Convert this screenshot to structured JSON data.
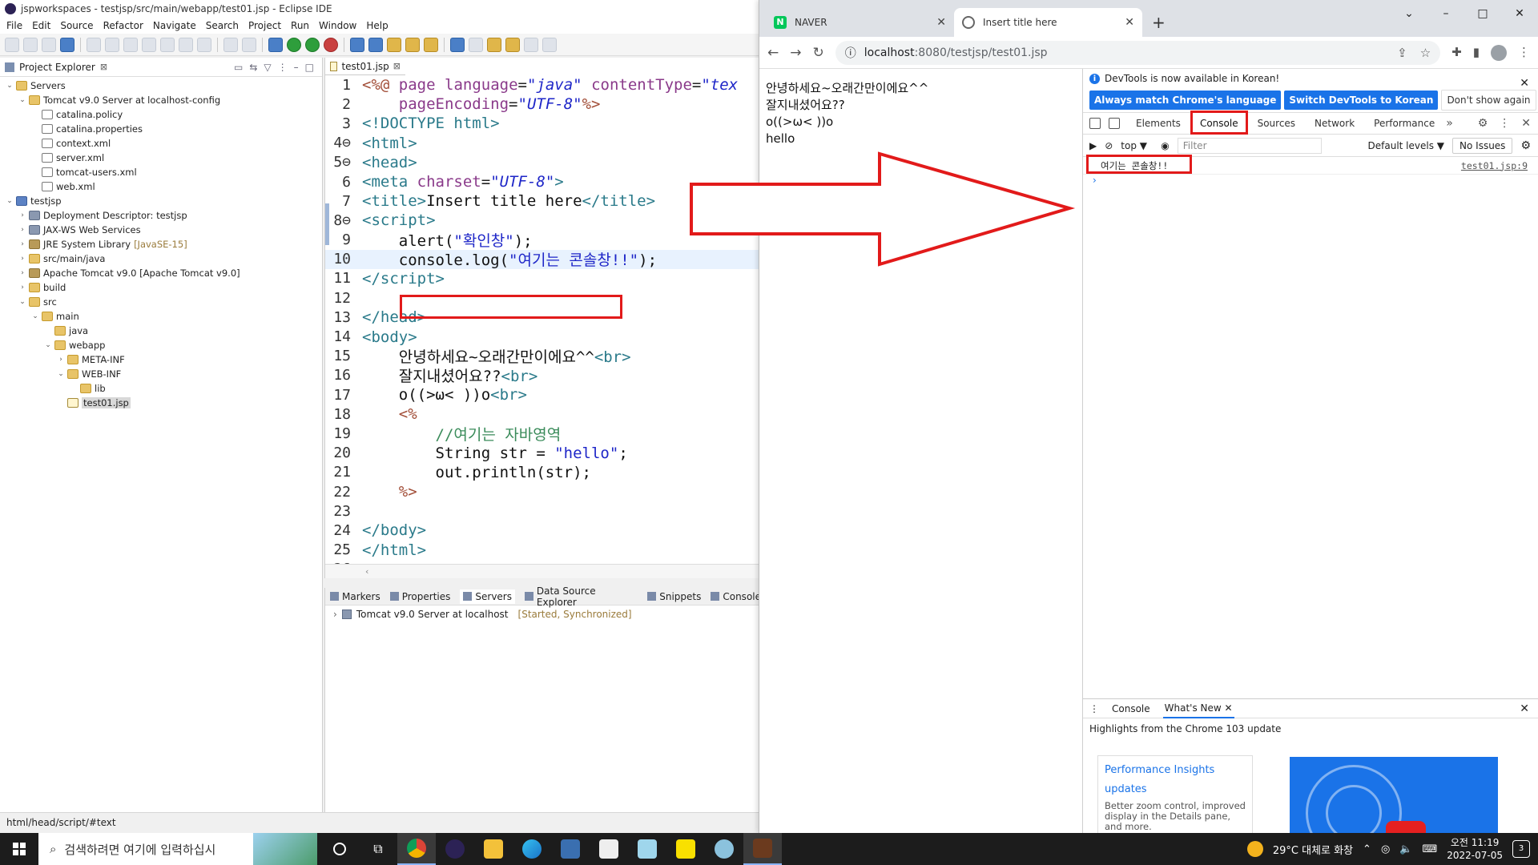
{
  "eclipse": {
    "window_title": "jspworkspaces - testjsp/src/main/webapp/test01.jsp - Eclipse IDE",
    "menu": [
      "File",
      "Edit",
      "Source",
      "Refactor",
      "Navigate",
      "Search",
      "Project",
      "Run",
      "Window",
      "Help"
    ],
    "project_explorer": {
      "tab_label": "Project Explorer",
      "tab_close": "⊠",
      "tree": [
        {
          "label": "Servers",
          "icon": "folder-icon",
          "twisty": "⌄",
          "level": 0
        },
        {
          "label": "Tomcat v9.0 Server at localhost-config",
          "icon": "folder-icon",
          "twisty": "⌄",
          "level": 1
        },
        {
          "label": "catalina.policy",
          "icon": "file-icon",
          "twisty": "",
          "level": 2
        },
        {
          "label": "catalina.properties",
          "icon": "file-icon",
          "twisty": "",
          "level": 2
        },
        {
          "label": "context.xml",
          "icon": "xml-file-icon",
          "twisty": "",
          "level": 2
        },
        {
          "label": "server.xml",
          "icon": "xml-file-icon",
          "twisty": "",
          "level": 2
        },
        {
          "label": "tomcat-users.xml",
          "icon": "xml-file-icon",
          "twisty": "",
          "level": 2
        },
        {
          "label": "web.xml",
          "icon": "xml-file-icon",
          "twisty": "",
          "level": 2
        },
        {
          "label": "testjsp",
          "icon": "project-icon",
          "twisty": "⌄",
          "level": 0
        },
        {
          "label": "Deployment Descriptor: testjsp",
          "icon": "descriptor-icon",
          "twisty": "›",
          "level": 1
        },
        {
          "label": "JAX-WS Web Services",
          "icon": "webservice-icon",
          "twisty": "›",
          "level": 1
        },
        {
          "label": "JRE System Library",
          "note": "[JavaSE-15]",
          "icon": "library-icon",
          "twisty": "›",
          "level": 1
        },
        {
          "label": "src/main/java",
          "icon": "source-folder-icon",
          "twisty": "›",
          "level": 1
        },
        {
          "label": "Apache Tomcat v9.0 [Apache Tomcat v9.0]",
          "icon": "library-icon",
          "twisty": "›",
          "level": 1
        },
        {
          "label": "build",
          "icon": "folder-icon",
          "twisty": "›",
          "level": 1
        },
        {
          "label": "src",
          "icon": "folder-icon",
          "twisty": "⌄",
          "level": 1
        },
        {
          "label": "main",
          "icon": "folder-icon",
          "twisty": "⌄",
          "level": 2
        },
        {
          "label": "java",
          "icon": "folder-icon",
          "twisty": "",
          "level": 3
        },
        {
          "label": "webapp",
          "icon": "folder-icon",
          "twisty": "⌄",
          "level": 3
        },
        {
          "label": "META-INF",
          "icon": "folder-icon",
          "twisty": "›",
          "level": 4
        },
        {
          "label": "WEB-INF",
          "icon": "folder-icon",
          "twisty": "⌄",
          "level": 4
        },
        {
          "label": "lib",
          "icon": "folder-icon",
          "twisty": "",
          "level": 5
        },
        {
          "label": "test01.jsp",
          "icon": "jsp-file-icon",
          "twisty": "",
          "level": 4,
          "selected": true
        }
      ]
    },
    "editor": {
      "tab_label": "test01.jsp",
      "tab_close": "⊠",
      "lines": [
        {
          "n": "1",
          "html": "<span class='k-dir'>&lt;%@</span> <span class='k-attr'>page</span> <span class='k-attr'>language</span>=<span class='k-ital'>\"java\"</span> <span class='k-attr'>contentType</span>=<span class='k-ital'>\"tex</span>"
        },
        {
          "n": "2",
          "html": "    <span class='k-attr'>pageEncoding</span>=<span class='k-ital'>\"UTF-8\"</span><span class='k-dir'>%&gt;</span>"
        },
        {
          "n": "3",
          "html": "<span class='k-tag'>&lt;!DOCTYPE html&gt;</span>"
        },
        {
          "n": "4⊖",
          "html": "<span class='k-tag'>&lt;html&gt;</span>"
        },
        {
          "n": "5⊖",
          "html": "<span class='k-tag'>&lt;head&gt;</span>"
        },
        {
          "n": "6",
          "html": "<span class='k-tag'>&lt;meta</span> <span class='k-attr'>charset</span>=<span class='k-ital'>\"UTF-8\"</span><span class='k-tag'>&gt;</span>"
        },
        {
          "n": "7",
          "html": "<span class='k-tag'>&lt;title&gt;</span><span class='k-plain'>Insert title here</span><span class='k-tag'>&lt;/title&gt;</span>"
        },
        {
          "n": "8⊖",
          "html": "<span class='k-tag'>&lt;script&gt;</span>"
        },
        {
          "n": "9",
          "html": "    <span class='k-plain'>alert(</span><span class='k-str'>\"확인창\"</span><span class='k-plain'>);</span>"
        },
        {
          "n": "10",
          "html": "    <span class='k-plain'>console.log(</span><span class='k-str'>\"여기는 콘솔창!!\"</span><span class='k-plain'>);</span>",
          "current": true
        },
        {
          "n": "11",
          "html": "<span class='k-tag'>&lt;/script&gt;</span>"
        },
        {
          "n": "12",
          "html": ""
        },
        {
          "n": "13",
          "html": "<span class='k-tag'>&lt;/head&gt;</span>"
        },
        {
          "n": "14",
          "html": "<span class='k-tag'>&lt;body&gt;</span>"
        },
        {
          "n": "15",
          "html": "    <span class='k-plain'>안녕하세요~오래간만이에요^^</span><span class='k-tag'>&lt;br&gt;</span>"
        },
        {
          "n": "16",
          "html": "    <span class='k-plain'>잘지내셨어요??</span><span class='k-tag'>&lt;br&gt;</span>"
        },
        {
          "n": "17",
          "html": "    <span class='k-plain'>o((&gt;ω&lt; ))o</span><span class='k-tag'>&lt;br&gt;</span>"
        },
        {
          "n": "18",
          "html": "    <span class='k-dir'>&lt;%</span>"
        },
        {
          "n": "19",
          "html": "        <span class='k-com'>//여기는 자바영역</span>"
        },
        {
          "n": "20",
          "html": "        <span class='k-plain'>String str = </span><span class='k-str'>\"hello\"</span><span class='k-plain'>;</span>"
        },
        {
          "n": "21",
          "html": "        <span class='k-plain'>out.println(str);</span>"
        },
        {
          "n": "22",
          "html": "    <span class='k-dir'>%&gt;</span>"
        },
        {
          "n": "23",
          "html": ""
        },
        {
          "n": "24",
          "html": "<span class='k-tag'>&lt;/body&gt;</span>"
        },
        {
          "n": "25",
          "html": "<span class='k-tag'>&lt;/html&gt;</span>"
        },
        {
          "n": "26",
          "html": ""
        }
      ]
    },
    "bottom_panel": {
      "tabs": [
        "Markers",
        "Properties",
        "Servers",
        "Data Source Explorer",
        "Snippets",
        "Console"
      ],
      "server_row": "Tomcat v9.0 Server at localhost",
      "server_status": "[Started, Synchronized]"
    },
    "status_bar": "html/head/script/#text"
  },
  "chrome": {
    "tabs": [
      {
        "label": "NAVER",
        "favicon": "N"
      },
      {
        "label": "Insert title here",
        "favicon": ""
      }
    ],
    "url_host": "localhost",
    "url_path": ":8080/testjsp/test01.jsp",
    "page_lines": [
      "안녕하세요~오래간만이에요^^",
      "잘지내셨어요??",
      "o((>ω< ))o",
      "hello"
    ],
    "devtools": {
      "info_text": "DevTools is now available in Korean!",
      "btn_match": "Always match Chrome's language",
      "btn_switch": "Switch DevTools to Korean",
      "btn_dont": "Don't show again",
      "tabs": [
        "Elements",
        "Console",
        "Sources",
        "Network",
        "Performance"
      ],
      "more": "»",
      "context": "top ▼",
      "filter_placeholder": "Filter",
      "levels": "Default levels ▼",
      "issues": "No Issues",
      "log_message": "여기는 콘솔창!!",
      "log_source": "test01.jsp:9",
      "prompt": "›",
      "drawer_tabs": [
        "Console",
        "What's New"
      ],
      "drawer_heading": "Highlights from the Chrome 103 update",
      "card_title": "Performance Insights updates",
      "card_desc": "Better zoom control, improved display in the Details pane, and more."
    }
  },
  "taskbar": {
    "search_placeholder": "검색하려면 여기에 입력하십시",
    "weather": "29°C  대체로 화창",
    "time": "오전 11:19",
    "date": "2022-07-05",
    "notifications": "3"
  },
  "colors": {
    "highlight_red": "#e21a1a",
    "devtools_blue": "#1a73e8"
  }
}
